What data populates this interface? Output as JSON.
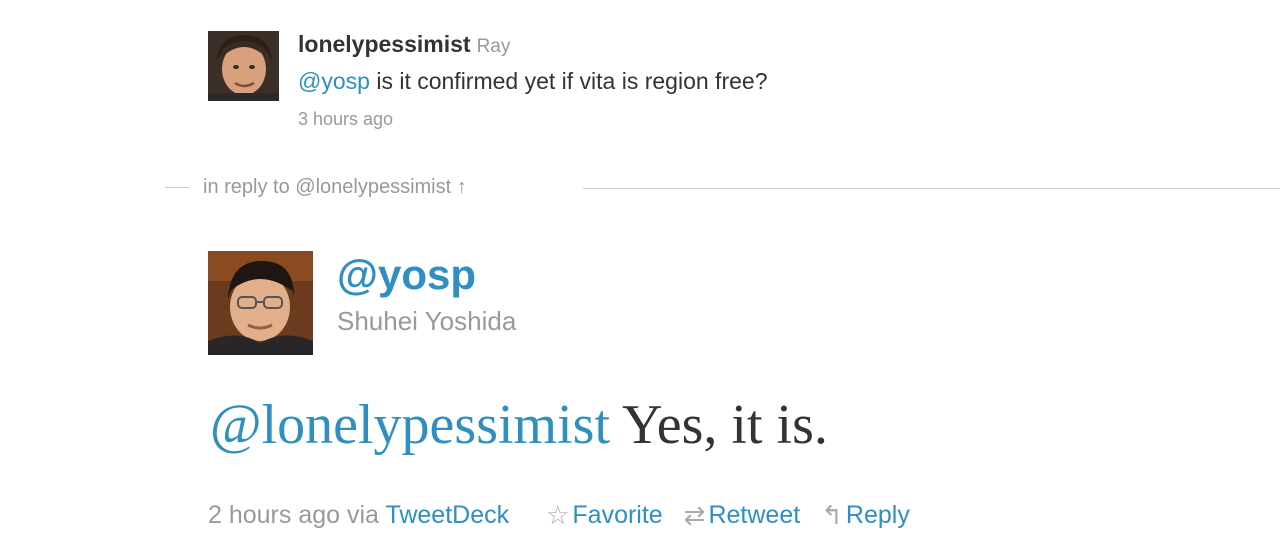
{
  "parent_tweet": {
    "screen_name": "lonelypessimist",
    "real_name": "Ray",
    "text_mention": "@yosp",
    "text_body": " is it confirmed yet if vita is region free?",
    "timestamp": "3 hours ago"
  },
  "in_reply_to": {
    "label": "in reply to @lonelypessimist",
    "arrow": "↑"
  },
  "main_tweet": {
    "screen_name": "@yosp",
    "real_name": "Shuhei Yoshida",
    "text_mention": "@lonelypessimist",
    "text_body": " Yes, it is.",
    "timestamp": "2 hours ago",
    "via_label": " via ",
    "source": "TweetDeck"
  },
  "actions": {
    "favorite": {
      "icon": "star-outline-icon",
      "glyph": "☆",
      "label": "Favorite"
    },
    "retweet": {
      "icon": "retweet-icon",
      "glyph": "⇄",
      "label": "Retweet"
    },
    "reply": {
      "icon": "reply-icon",
      "glyph": "↰",
      "label": "Reply"
    }
  },
  "colors": {
    "link": "#2f8fc1",
    "text": "#333333",
    "muted": "#999999",
    "divider": "#cccccc"
  }
}
